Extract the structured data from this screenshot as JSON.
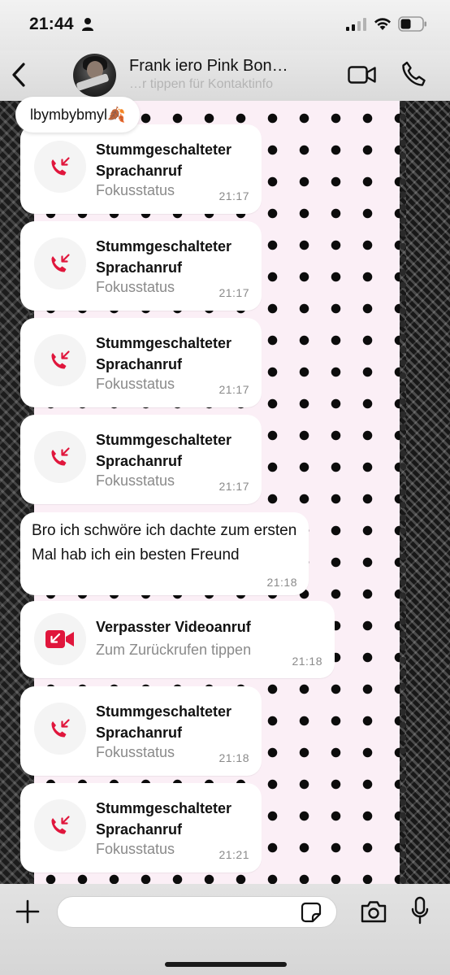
{
  "status_bar": {
    "time": "21:44"
  },
  "header": {
    "contact_name": "Frank iero Pink Bon…",
    "subtitle": "…r tippen für Kontaktinfo"
  },
  "pinned_label": "lbymbybmyl🍂",
  "messages": [
    {
      "type": "call",
      "title": "Stummgeschalteter Sprachanruf",
      "subtitle": "Fokusstatus",
      "time": "21:17"
    },
    {
      "type": "call",
      "title": "Stummgeschalteter Sprachanruf",
      "subtitle": "Fokusstatus",
      "time": "21:17"
    },
    {
      "type": "call",
      "title": "Stummgeschalteter Sprachanruf",
      "subtitle": "Fokusstatus",
      "time": "21:17"
    },
    {
      "type": "call",
      "title": "Stummgeschalteter Sprachanruf",
      "subtitle": "Fokusstatus",
      "time": "21:17"
    },
    {
      "type": "text",
      "text": "Bro ich schwöre ich dachte zum ersten Mal hab ich ein besten Freund",
      "time": "21:18"
    },
    {
      "type": "video",
      "title": "Verpasster Videoanruf",
      "subtitle": "Zum Zurückrufen tippen",
      "time": "21:18"
    },
    {
      "type": "call",
      "title": "Stummgeschalteter Sprachanruf",
      "subtitle": "Fokusstatus",
      "time": "21:18"
    },
    {
      "type": "call",
      "title": "Stummgeschalteter Sprachanruf",
      "subtitle": "Fokusstatus",
      "time": "21:21"
    }
  ],
  "composer": {
    "placeholder": ""
  },
  "colors": {
    "accent_red": "#e0163c",
    "chat_background": "#fbeff6"
  }
}
